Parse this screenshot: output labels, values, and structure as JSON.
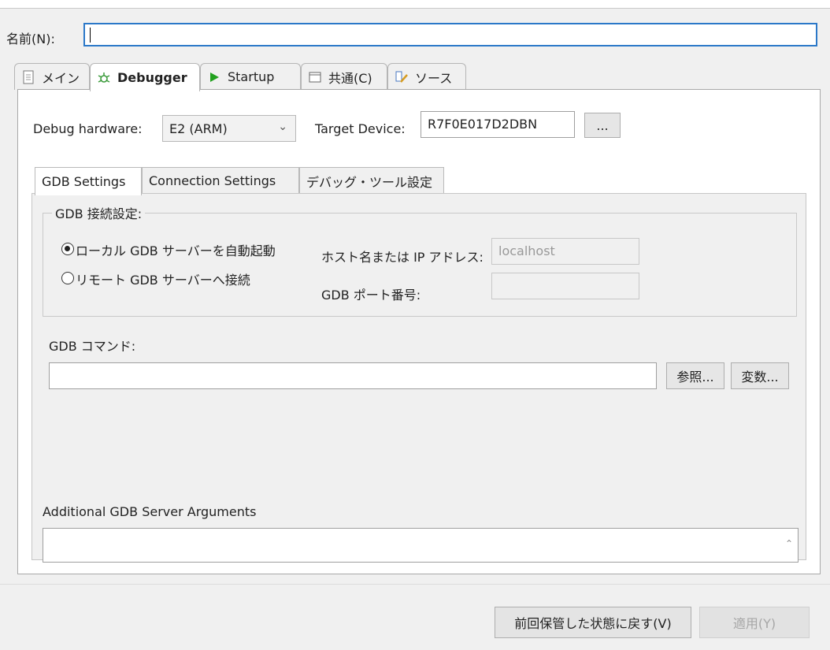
{
  "name_field": {
    "label": "名前(N):",
    "value": ""
  },
  "tabs": [
    {
      "label": "メイン",
      "icon": "document-icon"
    },
    {
      "label": "Debugger",
      "icon": "bug-icon"
    },
    {
      "label": "Startup",
      "icon": "play-icon"
    },
    {
      "label": "共通(C)",
      "icon": "window-icon"
    },
    {
      "label": "ソース",
      "icon": "source-icon"
    }
  ],
  "debugger": {
    "hardware_label": "Debug hardware:",
    "hardware_value": "E2 (ARM)",
    "target_label": "Target Device:",
    "target_value": "R7F0E017D2DBN",
    "browse_label": "..."
  },
  "subtabs": [
    "GDB Settings",
    "Connection Settings",
    "デバッグ・ツール設定"
  ],
  "gdb": {
    "group_title": "GDB 接続設定:",
    "radio_local": "ローカル GDB サーバーを自動起動",
    "radio_remote": "リモート GDB サーバーへ接続",
    "host_label": "ホスト名または IP アドレス:",
    "host_value": "localhost",
    "port_label": "GDB ポート番号:",
    "port_value": "",
    "command_label": "GDB コマンド:",
    "command_value": "",
    "browse_label": "参照...",
    "variables_label": "変数...",
    "additional_label": "Additional GDB Server Arguments",
    "additional_value": ""
  },
  "footer": {
    "revert_label": "前回保管した状態に戻す(V)",
    "apply_label": "適用(Y)"
  },
  "colors": {
    "focus_border": "#2b78c8",
    "play_green": "#22a11e"
  }
}
